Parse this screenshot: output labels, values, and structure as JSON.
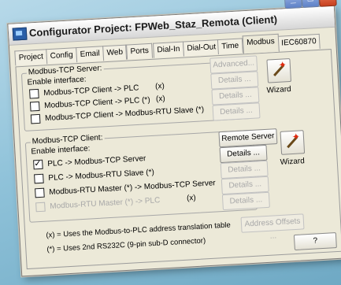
{
  "window": {
    "title": "Configurator Project: FPWeb_Staz_Remota (Client)",
    "min_glyph": "_",
    "max_glyph": "□",
    "close_glyph": "×"
  },
  "tabs": [
    "Project",
    "Config",
    "Email",
    "Web",
    "Ports",
    "Dial-In",
    "Dial-Out",
    "Time",
    "Modbus",
    "IEC60870"
  ],
  "active_tab": "Modbus",
  "server": {
    "title": "Modbus-TCP Server:",
    "enable_label": "Enable interface:",
    "options": [
      {
        "label": "Modbus-TCP Client -> PLC",
        "mark": "(x)",
        "checked": false
      },
      {
        "label": "Modbus-TCP Client -> PLC (*)",
        "mark": "(x)",
        "checked": false
      },
      {
        "label": "Modbus-TCP Client -> Modbus-RTU Slave (*)",
        "mark": "",
        "checked": false
      }
    ],
    "advanced_label": "Advanced...",
    "details_label": "Details ...",
    "wizard_label": "Wizard"
  },
  "client": {
    "title": "Modbus-TCP Client:",
    "enable_label": "Enable interface:",
    "options": [
      {
        "label": "PLC -> Modbus-TCP Server",
        "checked": true,
        "disabled": false,
        "mark": ""
      },
      {
        "label": "PLC -> Modbus-RTU Slave (*)",
        "checked": false,
        "disabled": false,
        "mark": ""
      },
      {
        "label": "Modbus-RTU Master (*) -> Modbus-TCP Server",
        "checked": false,
        "disabled": false,
        "mark": ""
      },
      {
        "label": "Modbus-RTU Master (*) -> PLC",
        "checked": false,
        "disabled": true,
        "mark": "(x)"
      }
    ],
    "remote_server_label": "Remote Server",
    "details_label": "Details ...",
    "wizard_label": "Wizard"
  },
  "notes": {
    "x_note": "(x) = Uses the Modbus-to-PLC address translation table",
    "star_note": "(*) = Uses 2nd RS232C (9-pin sub-D connector)",
    "address_offsets_label": "Address Offsets ..."
  },
  "help_label": "?"
}
